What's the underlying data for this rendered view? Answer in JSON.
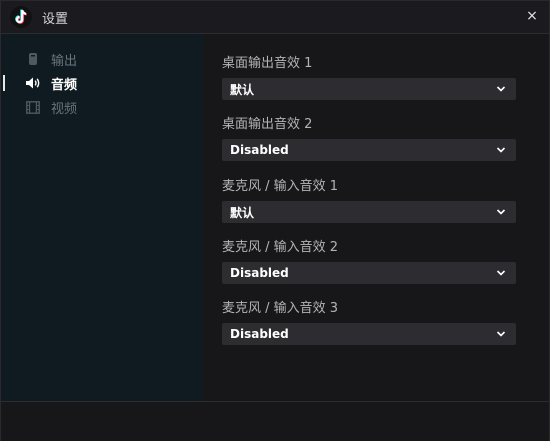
{
  "window": {
    "title": "设置",
    "close_symbol": "×"
  },
  "sidebar": {
    "items": [
      {
        "label": "输出",
        "icon": "output-icon",
        "active": false
      },
      {
        "label": "音频",
        "icon": "speaker-icon",
        "active": true
      },
      {
        "label": "视频",
        "icon": "film-icon",
        "active": false
      }
    ]
  },
  "audio": {
    "fields": [
      {
        "label": "桌面输出音效 1",
        "value": "默认"
      },
      {
        "label": "桌面输出音效 2",
        "value": "Disabled"
      },
      {
        "label": "麦克风 / 输入音效 1",
        "value": "默认"
      },
      {
        "label": "麦克风 / 输入音效 2",
        "value": "Disabled"
      },
      {
        "label": "麦克风 / 输入音效 3",
        "value": "Disabled"
      }
    ]
  },
  "colors": {
    "sidebar_bg": "#0f1b20",
    "window_bg": "#17171a",
    "select_bg": "#2c2c31",
    "brand_cyan": "#25f4ee",
    "brand_red": "#fe2c55"
  }
}
